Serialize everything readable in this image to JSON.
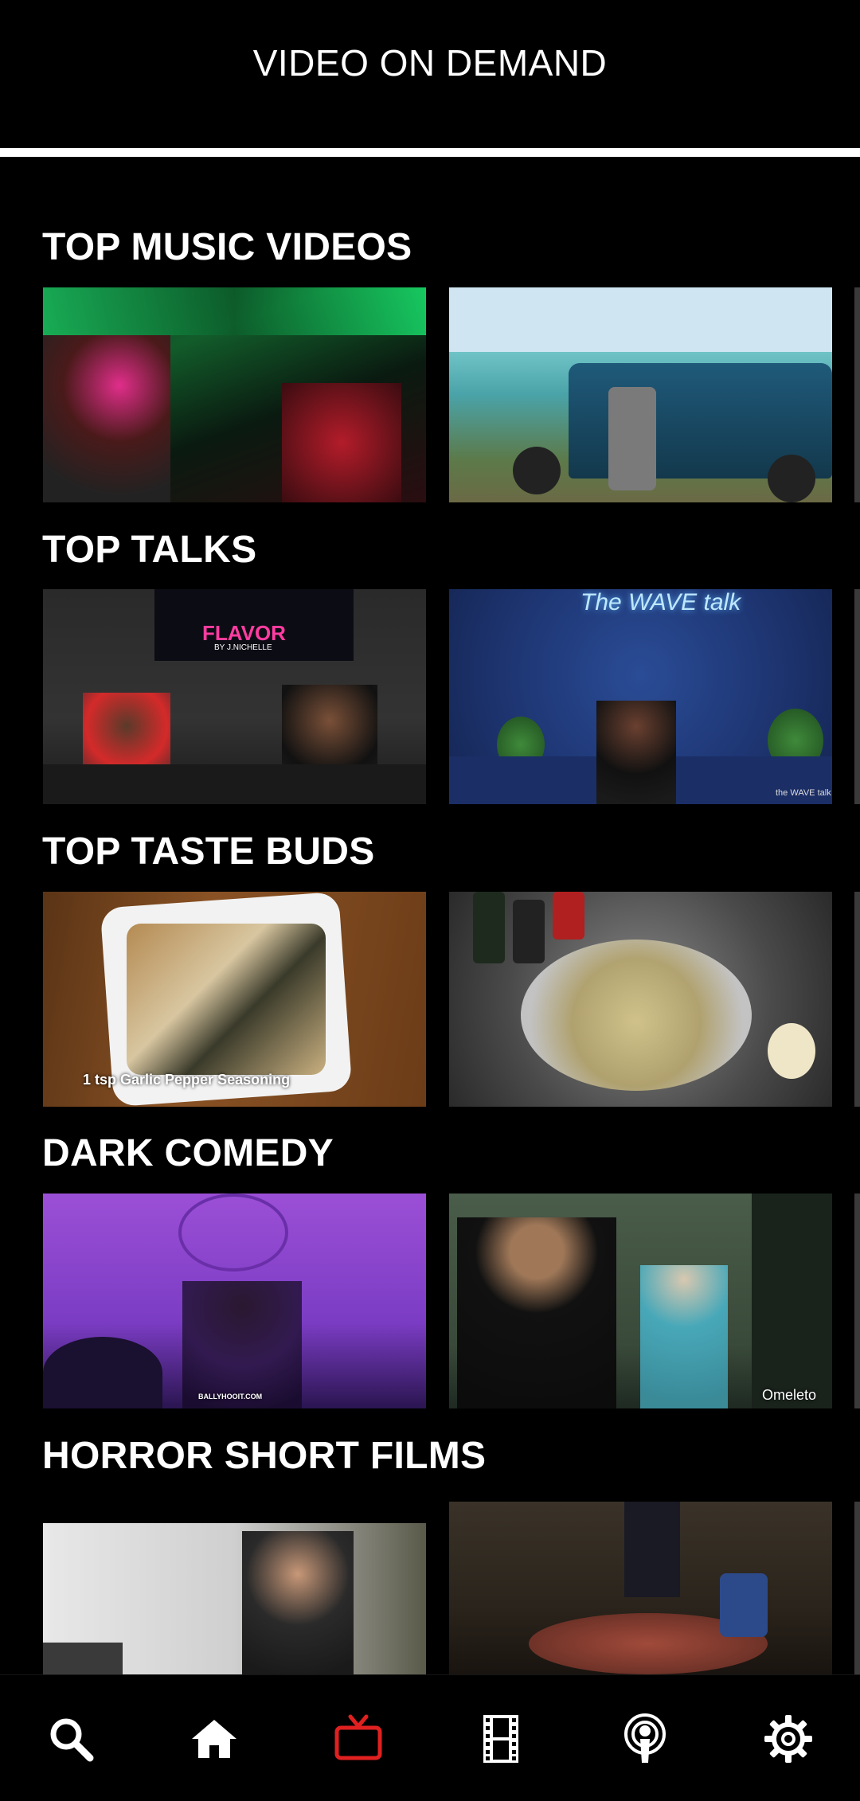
{
  "header": {
    "title": "VIDEO ON DEMAND"
  },
  "sections": [
    {
      "title": "TOP MUSIC VIDEOS",
      "thumbnails": [
        {
          "caption": ""
        },
        {
          "caption": ""
        }
      ]
    },
    {
      "title": "TOP TALKS",
      "thumbnails": [
        {
          "caption": "FLAVOR",
          "subcaption": "BY J.NICHELLE"
        },
        {
          "caption": "The WAVE talk",
          "subcaption": "the WAVE talk"
        }
      ]
    },
    {
      "title": "TOP TASTE BUDS",
      "thumbnails": [
        {
          "caption": "1 tsp Garlic Pepper Seasoning"
        },
        {
          "caption": ""
        }
      ]
    },
    {
      "title": "DARK COMEDY",
      "thumbnails": [
        {
          "caption": "BALLYHOOIT.COM"
        },
        {
          "caption": "Omeleto"
        }
      ]
    },
    {
      "title": "HORROR SHORT FILMS",
      "thumbnails": [
        {
          "caption": ""
        },
        {
          "caption": ""
        }
      ]
    }
  ],
  "bottom_nav": {
    "items": [
      {
        "icon": "search-icon",
        "active": false
      },
      {
        "icon": "home-icon",
        "active": false
      },
      {
        "icon": "tv-icon",
        "active": true
      },
      {
        "icon": "film-icon",
        "active": false
      },
      {
        "icon": "podcast-icon",
        "active": false
      },
      {
        "icon": "gear-icon",
        "active": false
      }
    ],
    "active_color": "#e02020",
    "inactive_color": "#ffffff"
  }
}
